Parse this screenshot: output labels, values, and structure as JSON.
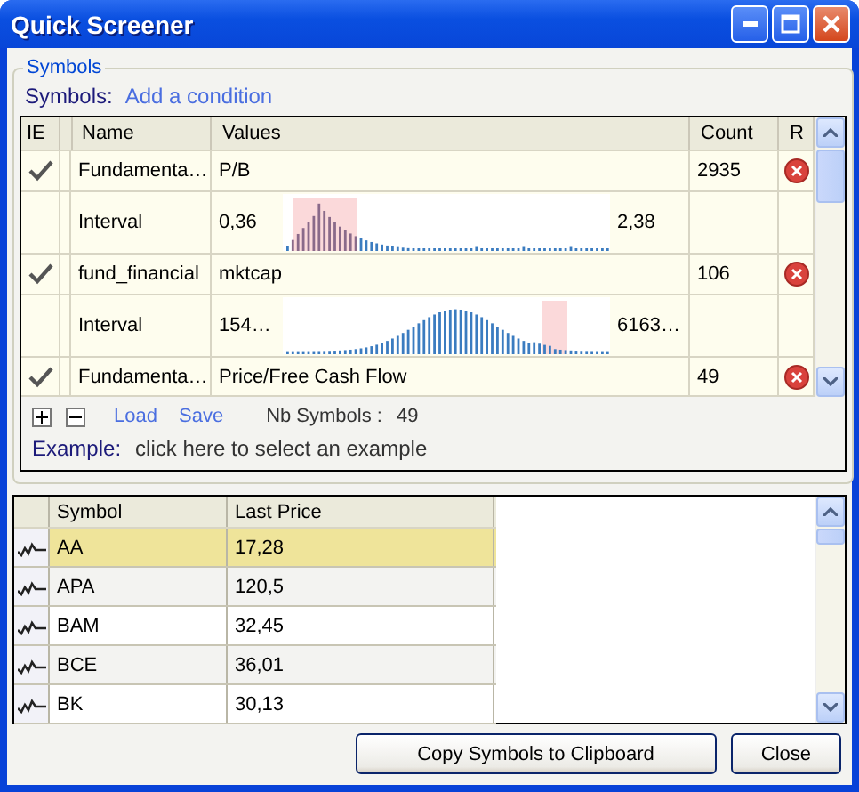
{
  "window": {
    "title": "Quick Screener"
  },
  "symbols_group": {
    "legend": "Symbols",
    "label": "Symbols:",
    "add_link": "Add a condition",
    "columns": [
      "IE",
      "Name",
      "Values",
      "Count",
      "R"
    ],
    "conditions": [
      {
        "enabled": true,
        "name": "Fundamenta…",
        "value": "P/B",
        "count": "2935",
        "interval": {
          "label": "Interval",
          "min": "0,36",
          "max": "2,38",
          "kind": "skewed"
        }
      },
      {
        "enabled": true,
        "name": "fund_financial",
        "value": "mktcap",
        "count": "106",
        "interval": {
          "label": "Interval",
          "min": "154…",
          "max": "6163…",
          "kind": "bell"
        }
      },
      {
        "enabled": true,
        "name": "Fundamenta…",
        "value": "Price/Free Cash Flow",
        "count": "49"
      }
    ],
    "load": "Load",
    "save": "Save",
    "nb_label": "Nb Symbols :",
    "nb_value": "49",
    "example_label": "Example:",
    "example_link": "click here to select an example"
  },
  "results": {
    "columns": [
      "Symbol",
      "Last Price"
    ],
    "rows": [
      {
        "symbol": "AA",
        "price": "17,28",
        "selected": true
      },
      {
        "symbol": "APA",
        "price": "120,5",
        "selected": false
      },
      {
        "symbol": "BAM",
        "price": "32,45",
        "selected": false
      },
      {
        "symbol": "BCE",
        "price": "36,01",
        "selected": false
      },
      {
        "symbol": "BK",
        "price": "30,13",
        "selected": false
      }
    ]
  },
  "buttons": [
    "Copy Symbols to Clipboard",
    "Close"
  ]
}
